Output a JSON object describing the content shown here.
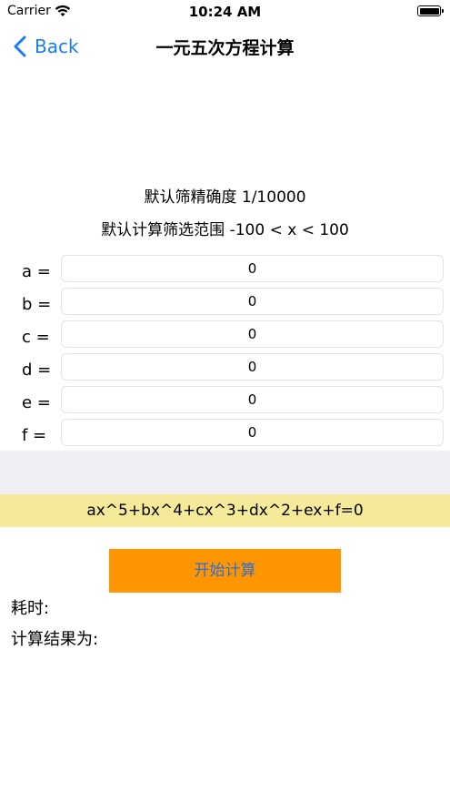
{
  "status_bar": {
    "carrier": "Carrier",
    "time": "10:24 AM"
  },
  "nav": {
    "back_label": "Back",
    "title": "一元五次方程计算"
  },
  "info": {
    "precision": "默认筛精确度 1/10000",
    "range": "默认计算筛选范围 -100 < x < 100"
  },
  "coefficients": [
    {
      "label": "a =",
      "value": "0"
    },
    {
      "label": "b =",
      "value": "0"
    },
    {
      "label": "c =",
      "value": "0"
    },
    {
      "label": "d =",
      "value": "0"
    },
    {
      "label": "e =",
      "value": "0"
    },
    {
      "label": "f =",
      "value": "0"
    }
  ],
  "equation": "ax^5+bx^4+cx^3+dx^2+ex+f=0",
  "start_button": "开始计算",
  "results": {
    "time_label": "耗时:",
    "result_label": "计算结果为:"
  },
  "colors": {
    "accent_blue": "#1a7cf5",
    "button_orange": "#ff9500",
    "equation_bg": "#f5ea99",
    "band_gray": "#efeff4"
  }
}
